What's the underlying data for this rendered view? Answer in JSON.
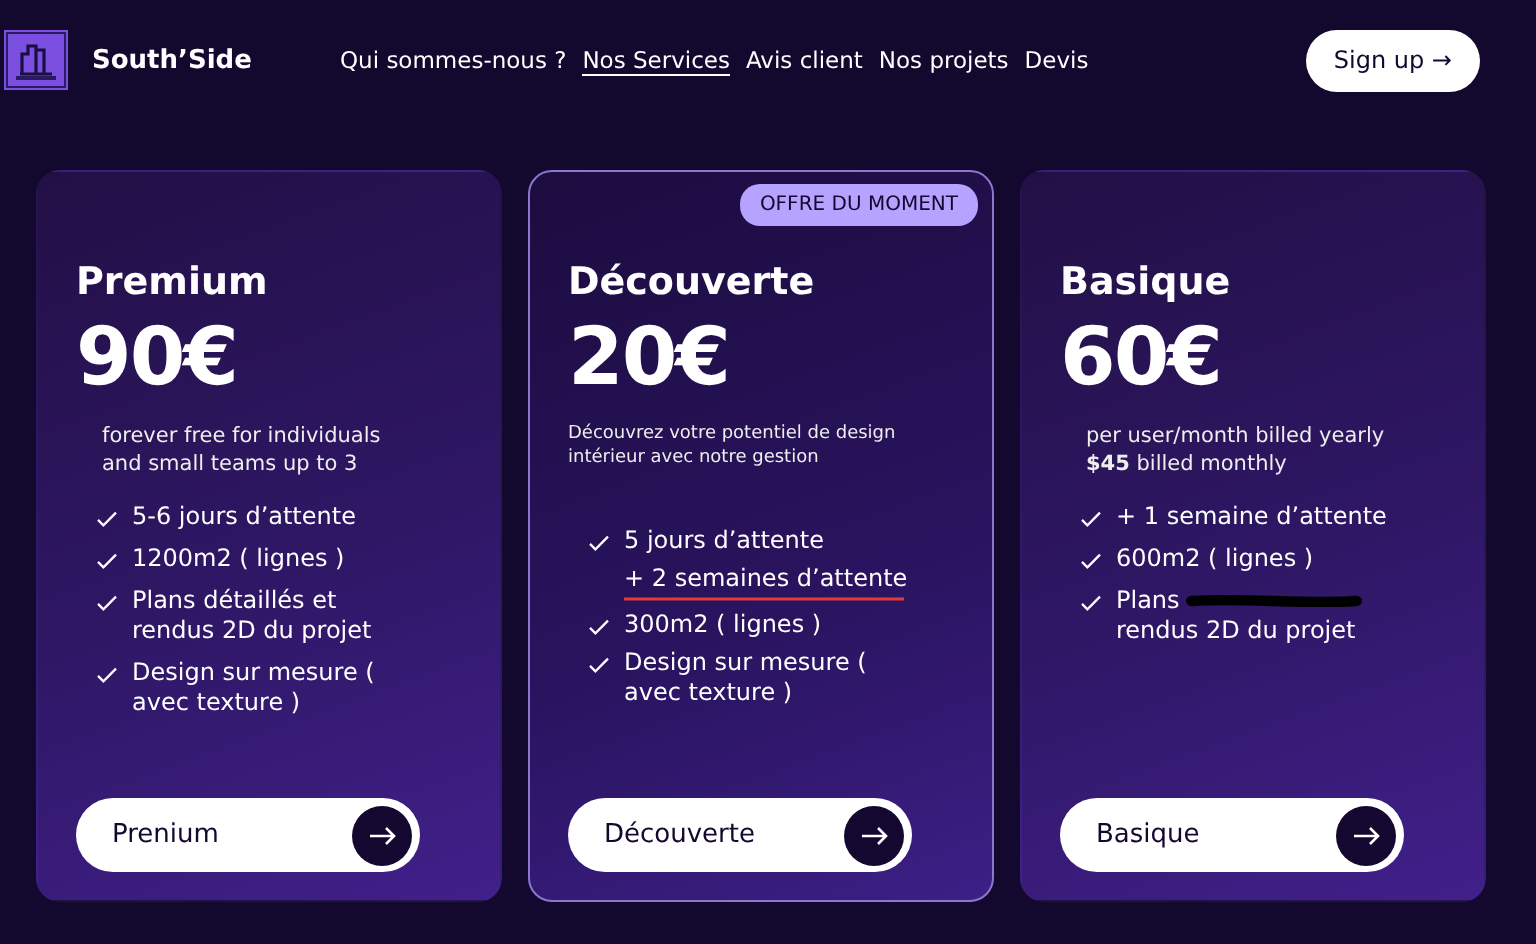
{
  "brand": {
    "name": "South’Side"
  },
  "nav": [
    {
      "label": "Qui sommes-nous ?",
      "selected": false
    },
    {
      "label": "Nos Services",
      "selected": true
    },
    {
      "label": "Avis client",
      "selected": false
    },
    {
      "label": "Nos projets",
      "selected": false
    },
    {
      "label": "Devis",
      "selected": false
    }
  ],
  "signup": {
    "label": "Sign up →"
  },
  "plans": [
    {
      "name": "Premium",
      "price": "90€",
      "featured": false,
      "description": "forever free for individuals\nand small teams up to 3",
      "features": [
        {
          "kind": "check",
          "lines": [
            "5-6 jours d’attente"
          ]
        },
        {
          "kind": "check",
          "lines": [
            "1200m2 ( lignes )"
          ]
        },
        {
          "kind": "check",
          "lines": [
            "Plans détaillés et",
            "rendus 2D du projet"
          ]
        },
        {
          "kind": "check",
          "lines": [
            "Design sur mesure (",
            "avec texture )"
          ]
        }
      ],
      "button": "Prenium"
    },
    {
      "name": "Découverte",
      "price": "20€",
      "featured": true,
      "badge": "OFFRE DU MOMENT",
      "description": "Découvrez votre potentiel de design\nintérieur avec notre gestion",
      "features": [
        {
          "kind": "check",
          "lines": [
            "5  jours d’attente"
          ]
        },
        {
          "kind": "struck",
          "lines": [
            "+ 2 semaines d’attente"
          ]
        },
        {
          "kind": "check",
          "lines": [
            "300m2 ( lignes )"
          ]
        },
        {
          "kind": "check",
          "lines": [
            "Design sur mesure (",
            "avec texture )"
          ]
        }
      ],
      "button": "Découverte"
    },
    {
      "name": "Basique",
      "price": "60€",
      "featured": false,
      "description": "per user/month billed yearly\n**$45** billed monthly",
      "features": [
        {
          "kind": "check",
          "lines": [
            "+ 1 semaine d’attente"
          ]
        },
        {
          "kind": "check",
          "lines": [
            "600m2 ( lignes )"
          ]
        },
        {
          "kind": "scribbled",
          "lines": [
            "Plans",
            "rendus 2D du projet"
          ]
        }
      ],
      "button": "Basique"
    }
  ]
}
